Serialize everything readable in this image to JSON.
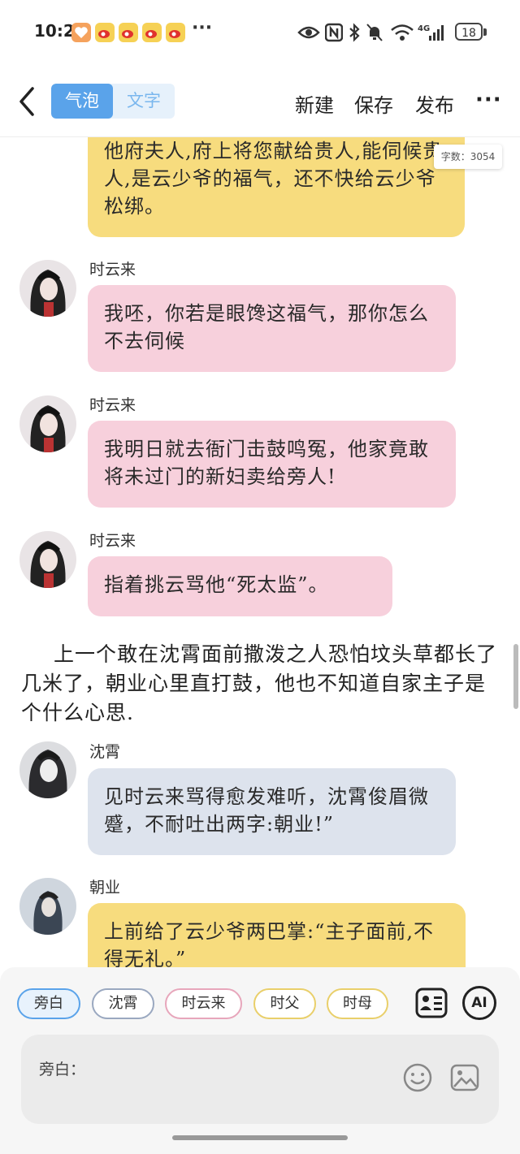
{
  "status_bar": {
    "time": "10:21",
    "more_dots": "···",
    "battery": "18"
  },
  "header": {
    "tab_bubble": "气泡",
    "tab_text": "文字",
    "new_label": "新建",
    "save_label": "保存",
    "publish_label": "发布",
    "more_label": "···"
  },
  "word_count": "字数：3054",
  "messages": [
    {
      "speaker": "",
      "text": "他府夫人,府上将您献给贵人,能伺候贵人,是云少爷的福气，还不快给云少爷松绑。",
      "color": "#f7dc7e"
    },
    {
      "speaker": "时云来",
      "text": "我呸，你若是眼馋这福气，那你怎么不去伺候",
      "color": "#f7d0dc"
    },
    {
      "speaker": "时云来",
      "text": "我明日就去衙门击鼓鸣冤，他家竟敢将未过门的新妇卖给旁人!",
      "color": "#f7d0dc"
    },
    {
      "speaker": "时云来",
      "text": "指着挑云骂他“死太监”。",
      "color": "#f7d0dc"
    },
    {
      "narration": "上一个敢在沈霄面前撒泼之人恐怕坟头草都长了几米了，朝业心里直打鼓，他也不知道自家主子是个什么心思."
    },
    {
      "speaker": "沈霄",
      "text": "见时云来骂得愈发难听，沈霄俊眉微蹙，不耐吐出两字:朝业!”",
      "color": "#dde3ed"
    },
    {
      "speaker": "朝业",
      "text": "上前给了云少爷两巴掌:“主子面前,不得无礼。”",
      "color": "#f7dc7e"
    }
  ],
  "roles": [
    {
      "label": "旁白",
      "color": "#5aa3ea",
      "active": true
    },
    {
      "label": "沈霄",
      "color": "#9aa8c0",
      "active": false
    },
    {
      "label": "时云来",
      "color": "#e7a6bb",
      "active": false
    },
    {
      "label": "时父",
      "color": "#e9cf6a",
      "active": false
    },
    {
      "label": "时母",
      "color": "#e9cf6a",
      "active": false
    }
  ],
  "icons": {
    "roles_icon": "contact-card-icon",
    "ai_label": "AI",
    "emoji_icon": "smiley-icon",
    "image_icon": "image-icon"
  },
  "input": {
    "label": "旁白："
  }
}
